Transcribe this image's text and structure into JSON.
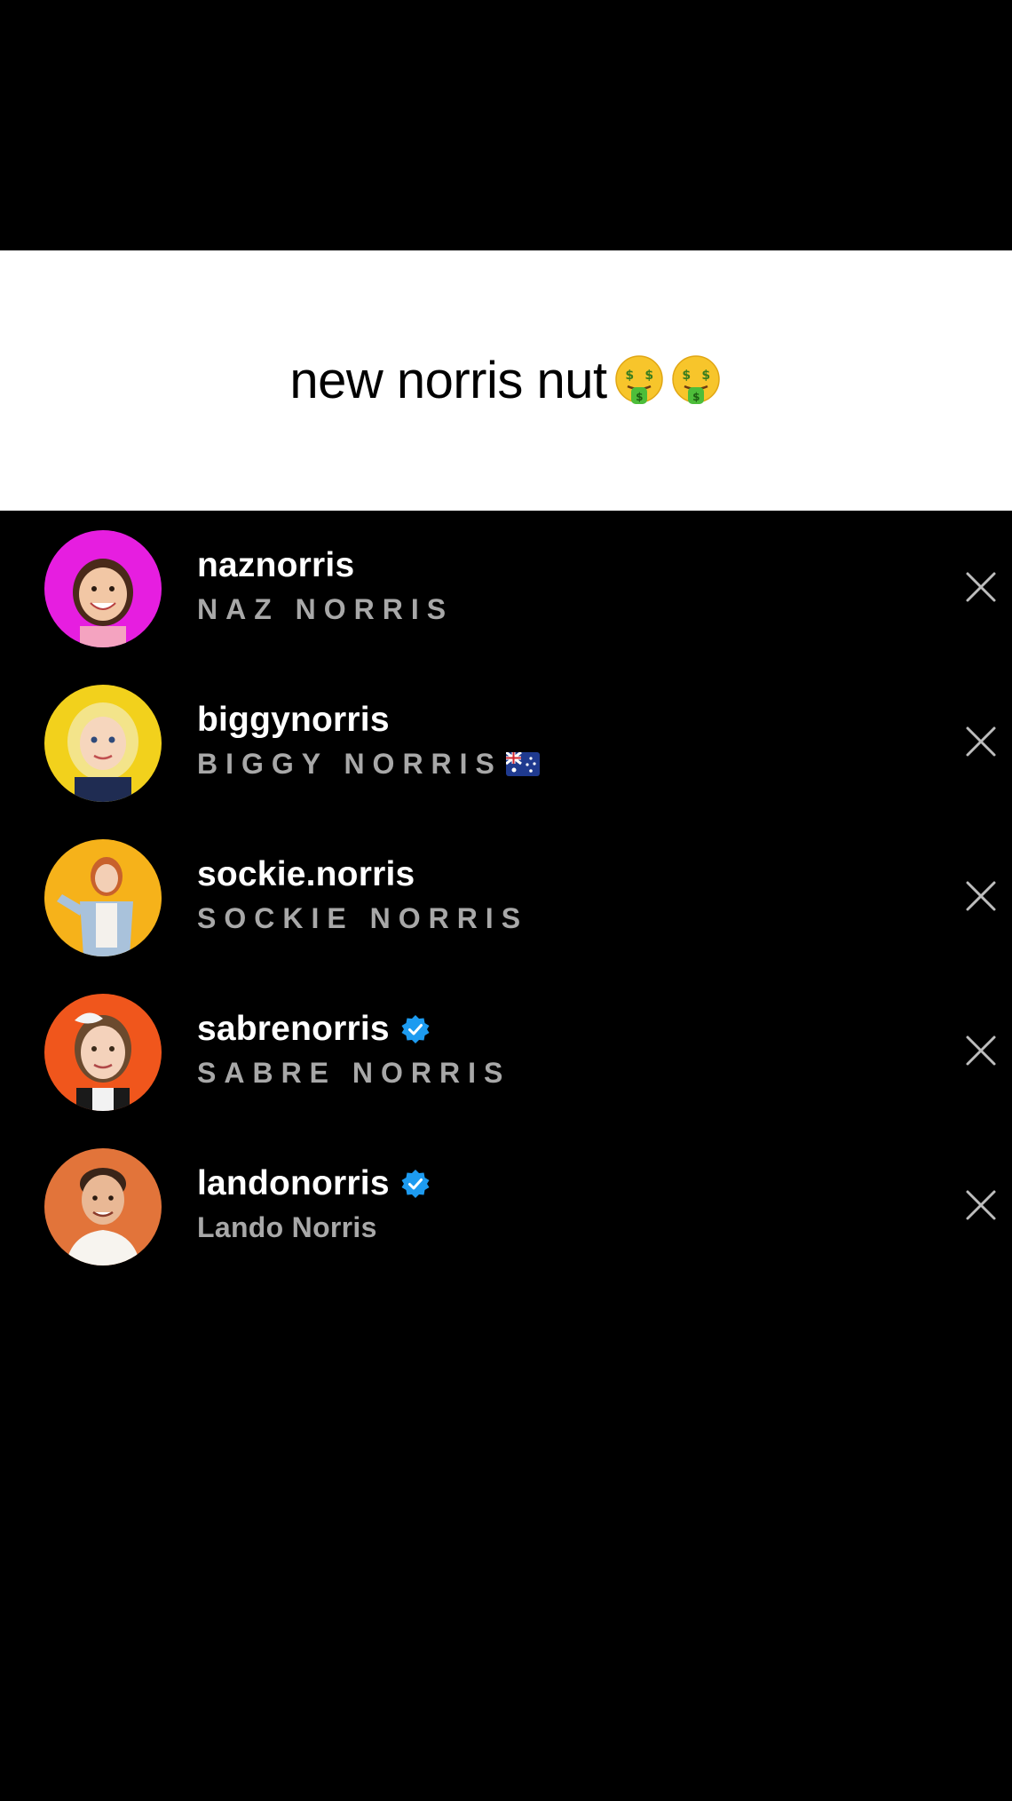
{
  "caption": {
    "text": "new norris nut",
    "emoji": [
      "money-mouth-face",
      "money-mouth-face"
    ]
  },
  "accounts": [
    {
      "username": "naznorris",
      "full_name": "NAZ NORRIS",
      "verified": false,
      "avatar_bg": "#e61ee0"
    },
    {
      "username": "biggynorris",
      "full_name": "BIGGY NORRIS",
      "verified": false,
      "flag": "australia-flag",
      "avatar_bg": "#f2d11c"
    },
    {
      "username": "sockie.norris",
      "full_name": "SOCKIE NORRIS",
      "verified": false,
      "avatar_bg": "#f6b21a"
    },
    {
      "username": "sabrenorris",
      "full_name": "SABRE NORRIS",
      "verified": true,
      "avatar_bg": "#f0561c"
    },
    {
      "username": "landonorris",
      "full_name": "Lando Norris",
      "verified": true,
      "avatar_bg": "#e2743a"
    }
  ],
  "colors": {
    "background": "#000000",
    "banner": "#ffffff",
    "username": "#ffffff",
    "fullname": "#a8a8a8",
    "verified": "#1d9bf0",
    "close": "#bdbdbd"
  }
}
